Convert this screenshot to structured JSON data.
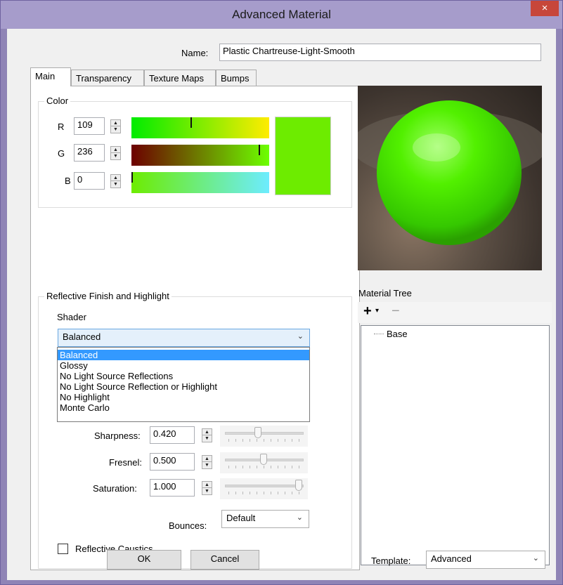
{
  "window": {
    "title": "Advanced Material",
    "close_glyph": "×"
  },
  "name": {
    "label": "Name:",
    "value": "Plastic Chartreuse-Light-Smooth"
  },
  "tabs": [
    {
      "label": "Main",
      "active": true
    },
    {
      "label": "Transparency",
      "active": false
    },
    {
      "label": "Texture Maps",
      "active": false
    },
    {
      "label": "Bumps",
      "active": false
    }
  ],
  "color": {
    "group_title": "Color",
    "r": {
      "label": "R",
      "value": "109",
      "fraction": 0.43
    },
    "g": {
      "label": "G",
      "value": "236",
      "fraction": 0.93
    },
    "b": {
      "label": "B",
      "value": "0",
      "fraction": 0.0
    },
    "swatch_hex": "#6dec00"
  },
  "reflective": {
    "group_title": "Reflective Finish and Highlight",
    "shader_label": "Shader",
    "shader_selected": "Balanced",
    "shader_options": [
      "Balanced",
      "Glossy",
      "No Light Source Reflections",
      "No Light Source Reflection or Highlight",
      "No Highlight",
      "Monte Carlo"
    ],
    "sharpness": {
      "label": "Sharpness:",
      "value": "0.420",
      "fraction": 0.42
    },
    "fresnel": {
      "label": "Fresnel:",
      "value": "0.500",
      "fraction": 0.5
    },
    "saturation": {
      "label": "Saturation:",
      "value": "1.000",
      "fraction": 1.0
    },
    "bounces_label": "Bounces:",
    "bounces_value": "Default",
    "caustics_label": "Reflective Caustics",
    "caustics_checked": false
  },
  "material_tree": {
    "label": "Material Tree",
    "add_glyph": "+",
    "add_dropdown_glyph": "▾",
    "remove_glyph": "−",
    "items": [
      "Base"
    ]
  },
  "buttons": {
    "ok": "OK",
    "cancel": "Cancel"
  },
  "template": {
    "label": "Template:",
    "value": "Advanced"
  },
  "icons": {
    "combo_arrow": "chevron-down-icon"
  }
}
